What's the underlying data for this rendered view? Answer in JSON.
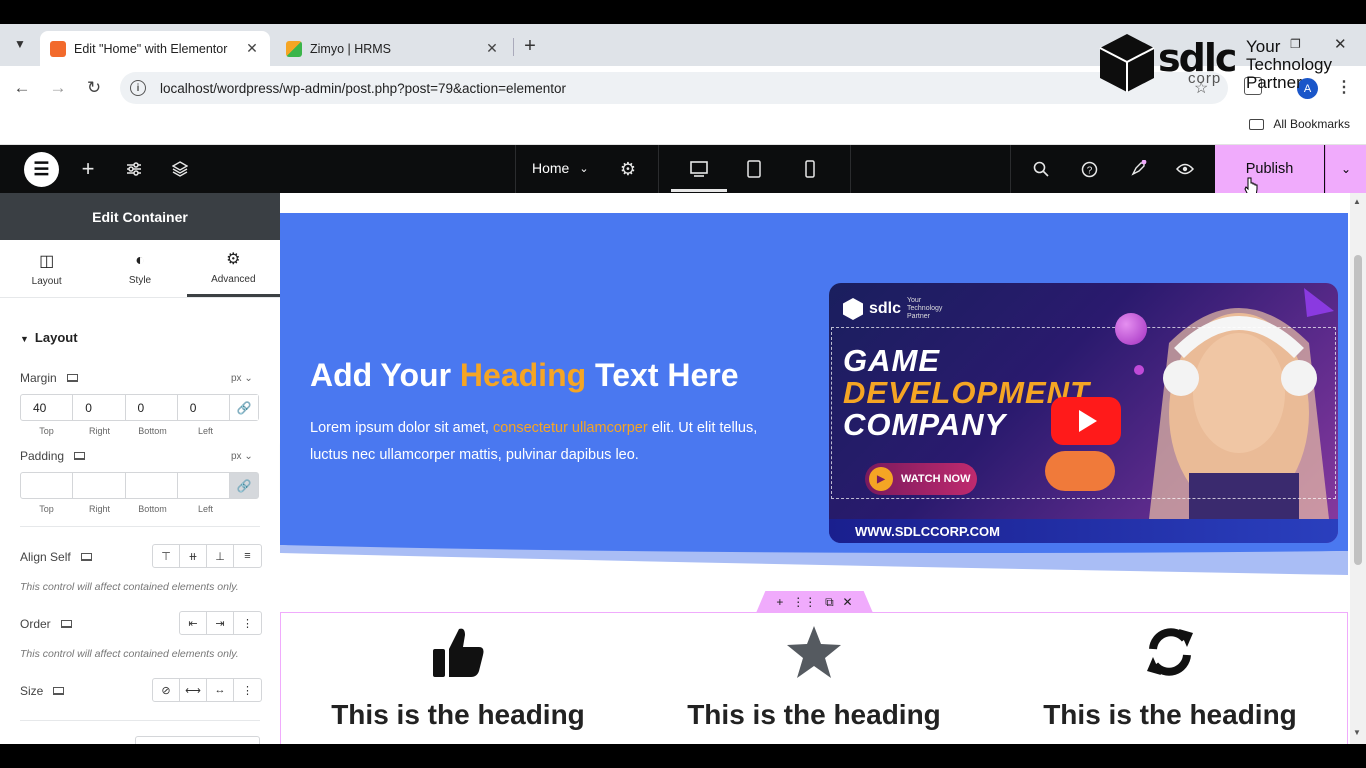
{
  "browser": {
    "tabs": [
      {
        "title": "Edit \"Home\" with Elementor",
        "favicon_color": "#f26a2c",
        "active": true
      },
      {
        "title": "Zimyo | HRMS",
        "favicon_color": "#3bb54a",
        "active": false
      }
    ],
    "url": "localhost/wordpress/wp-admin/post.php?post=79&action=elementor",
    "profile_initial": "A",
    "bookmarks_label": "All Bookmarks"
  },
  "watermark": {
    "word": "sdlc",
    "corp": "corp",
    "tagline_1": "Your",
    "tagline_2": "Technology",
    "tagline_3": "Partner"
  },
  "elementor_bar": {
    "page_name": "Home",
    "publish_label": "Publish",
    "accent": "#f0abfc"
  },
  "panel": {
    "header": "Edit Container",
    "tabs": [
      {
        "label": "Layout",
        "icon": "layout-icon"
      },
      {
        "label": "Style",
        "icon": "style-icon"
      },
      {
        "label": "Advanced",
        "icon": "gear-icon"
      }
    ],
    "section_title": "Layout",
    "margin": {
      "label": "Margin",
      "unit": "px",
      "top": "40",
      "right": "0",
      "bottom": "0",
      "left": "0"
    },
    "padding": {
      "label": "Padding",
      "unit": "px",
      "top": "",
      "right": "",
      "bottom": "",
      "left": ""
    },
    "dim_labels": {
      "top": "Top",
      "right": "Right",
      "bottom": "Bottom",
      "left": "Left"
    },
    "align_self": {
      "label": "Align Self",
      "note": "This control will affect contained elements only."
    },
    "order": {
      "label": "Order",
      "note": "This control will affect contained elements only."
    },
    "size": {
      "label": "Size"
    }
  },
  "hero": {
    "heading_before": "Add Your ",
    "heading_highlight": "Heading",
    "heading_after": " Text Here",
    "text_before": "Lorem ipsum dolor sit amet, ",
    "text_highlight": "consectetur ullamcorper",
    "text_after": " elit. Ut elit tellus, luctus nec ullamcorper mattis, pulvinar dapibus leo.",
    "bg_color": "#4a78f0",
    "highlight_color": "#f5a524"
  },
  "video": {
    "logo_word": "sdlc",
    "logo_tag": "Your Technology Partner",
    "line1": "GAME",
    "line2": "DEVELOPMENT",
    "line3": "COMPANY",
    "watch_label": "WATCH NOW",
    "url": "WWW.SDLCCORP.COM"
  },
  "features": [
    {
      "icon": "thumbs-up-icon",
      "heading": "This is the heading"
    },
    {
      "icon": "star-icon",
      "heading": "This is the heading"
    },
    {
      "icon": "sync-icon",
      "heading": "This is the heading"
    }
  ]
}
